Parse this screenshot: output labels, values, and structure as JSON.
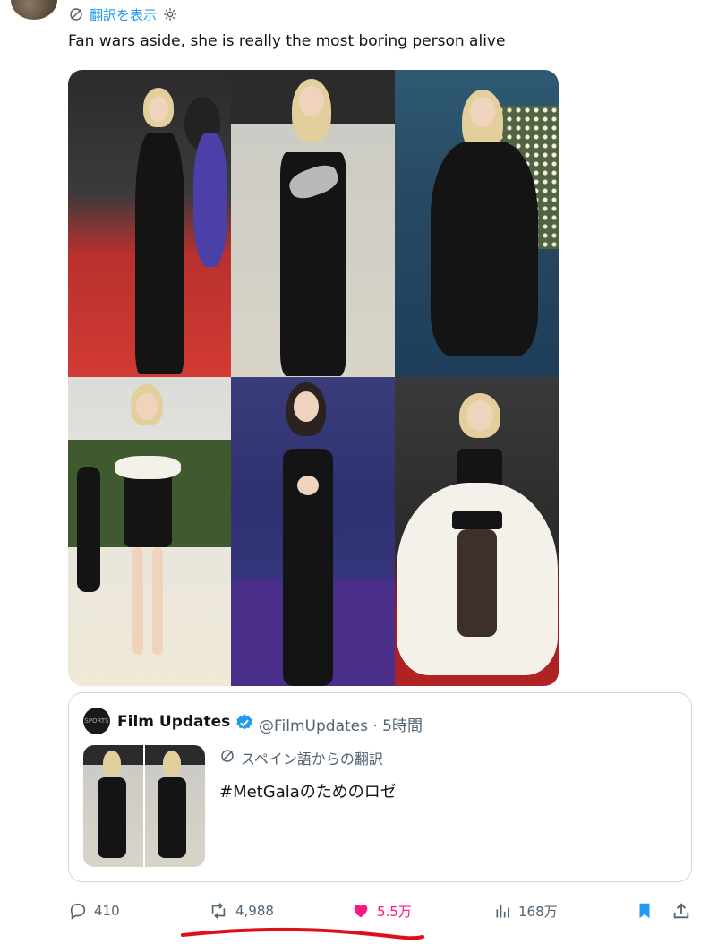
{
  "tweet": {
    "translate_label": "翻訳を表示",
    "text": "Fan wars aside, she is really the most boring person alive",
    "media": [
      {
        "alt": "photo-1"
      },
      {
        "alt": "photo-2"
      },
      {
        "alt": "photo-3"
      },
      {
        "alt": "photo-4"
      },
      {
        "alt": "photo-5"
      },
      {
        "alt": "photo-6"
      }
    ]
  },
  "quote": {
    "avatar_text": "SPORTS",
    "name": "Film Updates",
    "handle_time": "@FilmUpdates · 5時間",
    "translation_label": "スペイン語からの翻訳",
    "text": "#MetGalaのためのロゼ"
  },
  "actions": {
    "replies": "410",
    "retweets": "4,988",
    "likes": "5.5万",
    "views": "168万"
  },
  "colors": {
    "accent": "#1d9bf0",
    "like": "#f91880",
    "muted": "#536471",
    "annotation_red": "#e0101a"
  },
  "icons": [
    "translate-icon",
    "gear-icon",
    "verified-badge-icon",
    "reply-icon",
    "retweet-icon",
    "heart-icon",
    "views-icon",
    "bookmark-icon",
    "share-icon"
  ]
}
